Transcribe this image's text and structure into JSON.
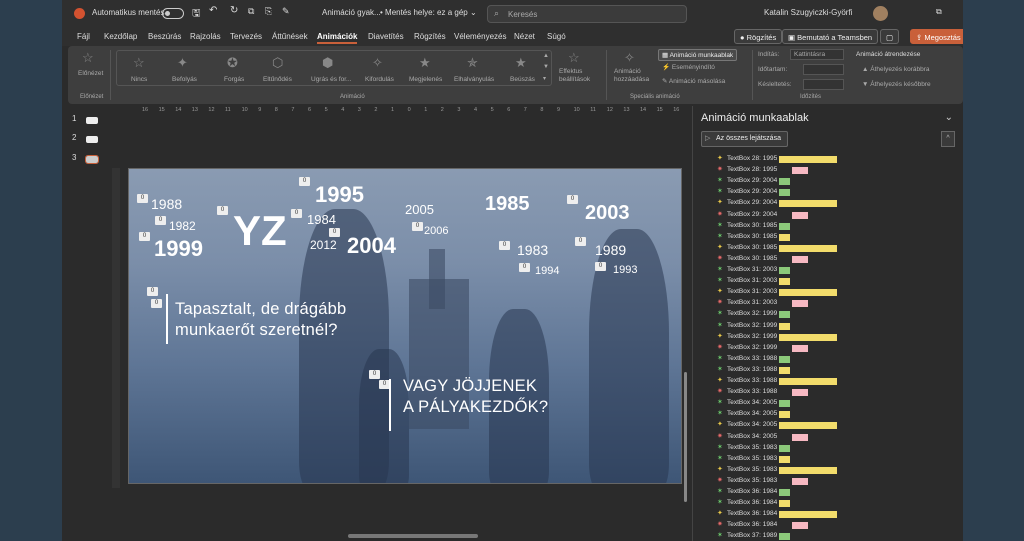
{
  "window": {
    "autosave_label": "Automatikus mentés",
    "doc_title": "Animáció gyak...",
    "save_location": "• Mentés helye: ez a gép ⌄",
    "search_placeholder": "Keresés",
    "user_name": "Katalin Szugyiczki-Györfi"
  },
  "menu": {
    "items": [
      "Fájl",
      "Kezdőlap",
      "Beszúrás",
      "Rajzolás",
      "Tervezés",
      "Áttűnések",
      "Animációk",
      "Diavetítés",
      "Rögzítés",
      "Véleményezés",
      "Nézet",
      "Súgó"
    ],
    "record_button": "Rögzítés",
    "present_teams_button": "Bemutató a Teamsben",
    "share_button": "Megosztás"
  },
  "ribbon": {
    "preview_label": "Előnézet",
    "preview_group": "Előnézet",
    "animations": [
      "Nincs",
      "Befolyás",
      "Forgás",
      "Eltűnődés",
      "Ugrás és for...",
      "Kifordulás",
      "Megjelenés",
      "Elhalványulás",
      "Beúszás"
    ],
    "effect_options": "Effektus beállítások",
    "animation_group": "Animáció",
    "add_animation": "Animáció hozzáadása",
    "animation_pane_button": "Animáció munkaablak",
    "trigger": "Eseményindító",
    "animation_painter": "Animáció másolása",
    "advanced_group": "Speciális animáció",
    "start_label": "Indítás:",
    "start_value": "Kattintásra",
    "duration_label": "Időtartam:",
    "delay_label": "Késleltetés:",
    "timing_group": "Időzítés",
    "reorder_label": "Animáció átrendezése",
    "move_earlier": "Áthelyezés korábbra",
    "move_later": "Áthelyezés későbbre"
  },
  "ruler": [
    "16",
    "15",
    "14",
    "13",
    "12",
    "11",
    "10",
    "9",
    "8",
    "7",
    "6",
    "5",
    "4",
    "3",
    "2",
    "1",
    "0",
    "1",
    "2",
    "3",
    "4",
    "5",
    "6",
    "7",
    "8",
    "9",
    "10",
    "11",
    "12",
    "13",
    "14",
    "15",
    "16"
  ],
  "thumbnails": [
    "1",
    "2",
    "3"
  ],
  "slide": {
    "years": [
      {
        "t": "1988",
        "s": 14
      },
      {
        "t": "1982",
        "s": 12
      },
      {
        "t": "1999",
        "s": 22
      },
      {
        "t": "YZ",
        "s": 42
      },
      {
        "t": "1995",
        "s": 22
      },
      {
        "t": "1984",
        "s": 13
      },
      {
        "t": "2012",
        "s": 12
      },
      {
        "t": "2004",
        "s": 22
      },
      {
        "t": "2005",
        "s": 13
      },
      {
        "t": "2006",
        "s": 11
      },
      {
        "t": "1985",
        "s": 20
      },
      {
        "t": "2003",
        "s": 20
      },
      {
        "t": "1983",
        "s": 14
      },
      {
        "t": "1994",
        "s": 11
      },
      {
        "t": "1989",
        "s": 14
      },
      {
        "t": "1993",
        "s": 11
      }
    ],
    "tag_label": "0",
    "text1_line1": "Tapasztalt, de drágább",
    "text1_line2": "munkaerőt szeretnél?",
    "text2_line1": "VAGY JÖJJENEK",
    "text2_line2": "A PÁLYAKEZDŐK?"
  },
  "pane": {
    "title": "Animáció munkaablak",
    "play_all": "Az összes lejátszása",
    "rows": [
      {
        "label": "TextBox 28: 1995",
        "type": "move",
        "color": "#f2dc6b"
      },
      {
        "label": "TextBox 28: 1995",
        "type": "exit",
        "color": "#f6b8c2"
      },
      {
        "label": "TextBox 29: 2004",
        "type": "entrance",
        "color": "#8cc97a"
      },
      {
        "label": "TextBox 29: 2004",
        "type": "entrance",
        "color": "#8cc97a"
      },
      {
        "label": "TextBox 29: 2004",
        "type": "move",
        "color": "#f2dc6b"
      },
      {
        "label": "TextBox 29: 2004",
        "type": "exit",
        "color": "#f6b8c2"
      },
      {
        "label": "TextBox 30: 1985",
        "type": "entrance",
        "color": "#8cc97a"
      },
      {
        "label": "TextBox 30: 1985",
        "type": "entrance",
        "color": "#f2dc6b"
      },
      {
        "label": "TextBox 30: 1985",
        "type": "move",
        "color": "#f2dc6b"
      },
      {
        "label": "TextBox 30: 1985",
        "type": "exit",
        "color": "#f6b8c2"
      },
      {
        "label": "TextBox 31: 2003",
        "type": "entrance",
        "color": "#8cc97a"
      },
      {
        "label": "TextBox 31: 2003",
        "type": "entrance",
        "color": "#f2dc6b"
      },
      {
        "label": "TextBox 31: 2003",
        "type": "move",
        "color": "#f2dc6b"
      },
      {
        "label": "TextBox 31: 2003",
        "type": "exit",
        "color": "#f6b8c2"
      },
      {
        "label": "TextBox 32: 1999",
        "type": "entrance",
        "color": "#8cc97a"
      },
      {
        "label": "TextBox 32: 1999",
        "type": "entrance",
        "color": "#f2dc6b"
      },
      {
        "label": "TextBox 32: 1999",
        "type": "move",
        "color": "#f2dc6b"
      },
      {
        "label": "TextBox 32: 1999",
        "type": "exit",
        "color": "#f6b8c2"
      },
      {
        "label": "TextBox 33: 1988",
        "type": "entrance",
        "color": "#8cc97a"
      },
      {
        "label": "TextBox 33: 1988",
        "type": "entrance",
        "color": "#f2dc6b"
      },
      {
        "label": "TextBox 33: 1988",
        "type": "move",
        "color": "#f2dc6b"
      },
      {
        "label": "TextBox 33: 1988",
        "type": "exit",
        "color": "#f6b8c2"
      },
      {
        "label": "TextBox 34: 2005",
        "type": "entrance",
        "color": "#8cc97a"
      },
      {
        "label": "TextBox 34: 2005",
        "type": "entrance",
        "color": "#f2dc6b"
      },
      {
        "label": "TextBox 34: 2005",
        "type": "move",
        "color": "#f2dc6b"
      },
      {
        "label": "TextBox 34: 2005",
        "type": "exit",
        "color": "#f6b8c2"
      },
      {
        "label": "TextBox 35: 1983",
        "type": "entrance",
        "color": "#8cc97a"
      },
      {
        "label": "TextBox 35: 1983",
        "type": "entrance",
        "color": "#f2dc6b"
      },
      {
        "label": "TextBox 35: 1983",
        "type": "move",
        "color": "#f2dc6b"
      },
      {
        "label": "TextBox 35: 1983",
        "type": "exit",
        "color": "#f6b8c2"
      },
      {
        "label": "TextBox 36: 1984",
        "type": "entrance",
        "color": "#8cc97a"
      },
      {
        "label": "TextBox 36: 1984",
        "type": "entrance",
        "color": "#f2dc6b"
      },
      {
        "label": "TextBox 36: 1984",
        "type": "move",
        "color": "#f2dc6b"
      },
      {
        "label": "TextBox 36: 1984",
        "type": "exit",
        "color": "#f6b8c2"
      },
      {
        "label": "TextBox 37: 1989",
        "type": "entrance",
        "color": "#8cc97a"
      }
    ]
  },
  "colors": {
    "accent": "#c9603a",
    "entrance": "#8cc97a",
    "emphasis": "#f2dc6b",
    "exit": "#f6b8c2"
  }
}
